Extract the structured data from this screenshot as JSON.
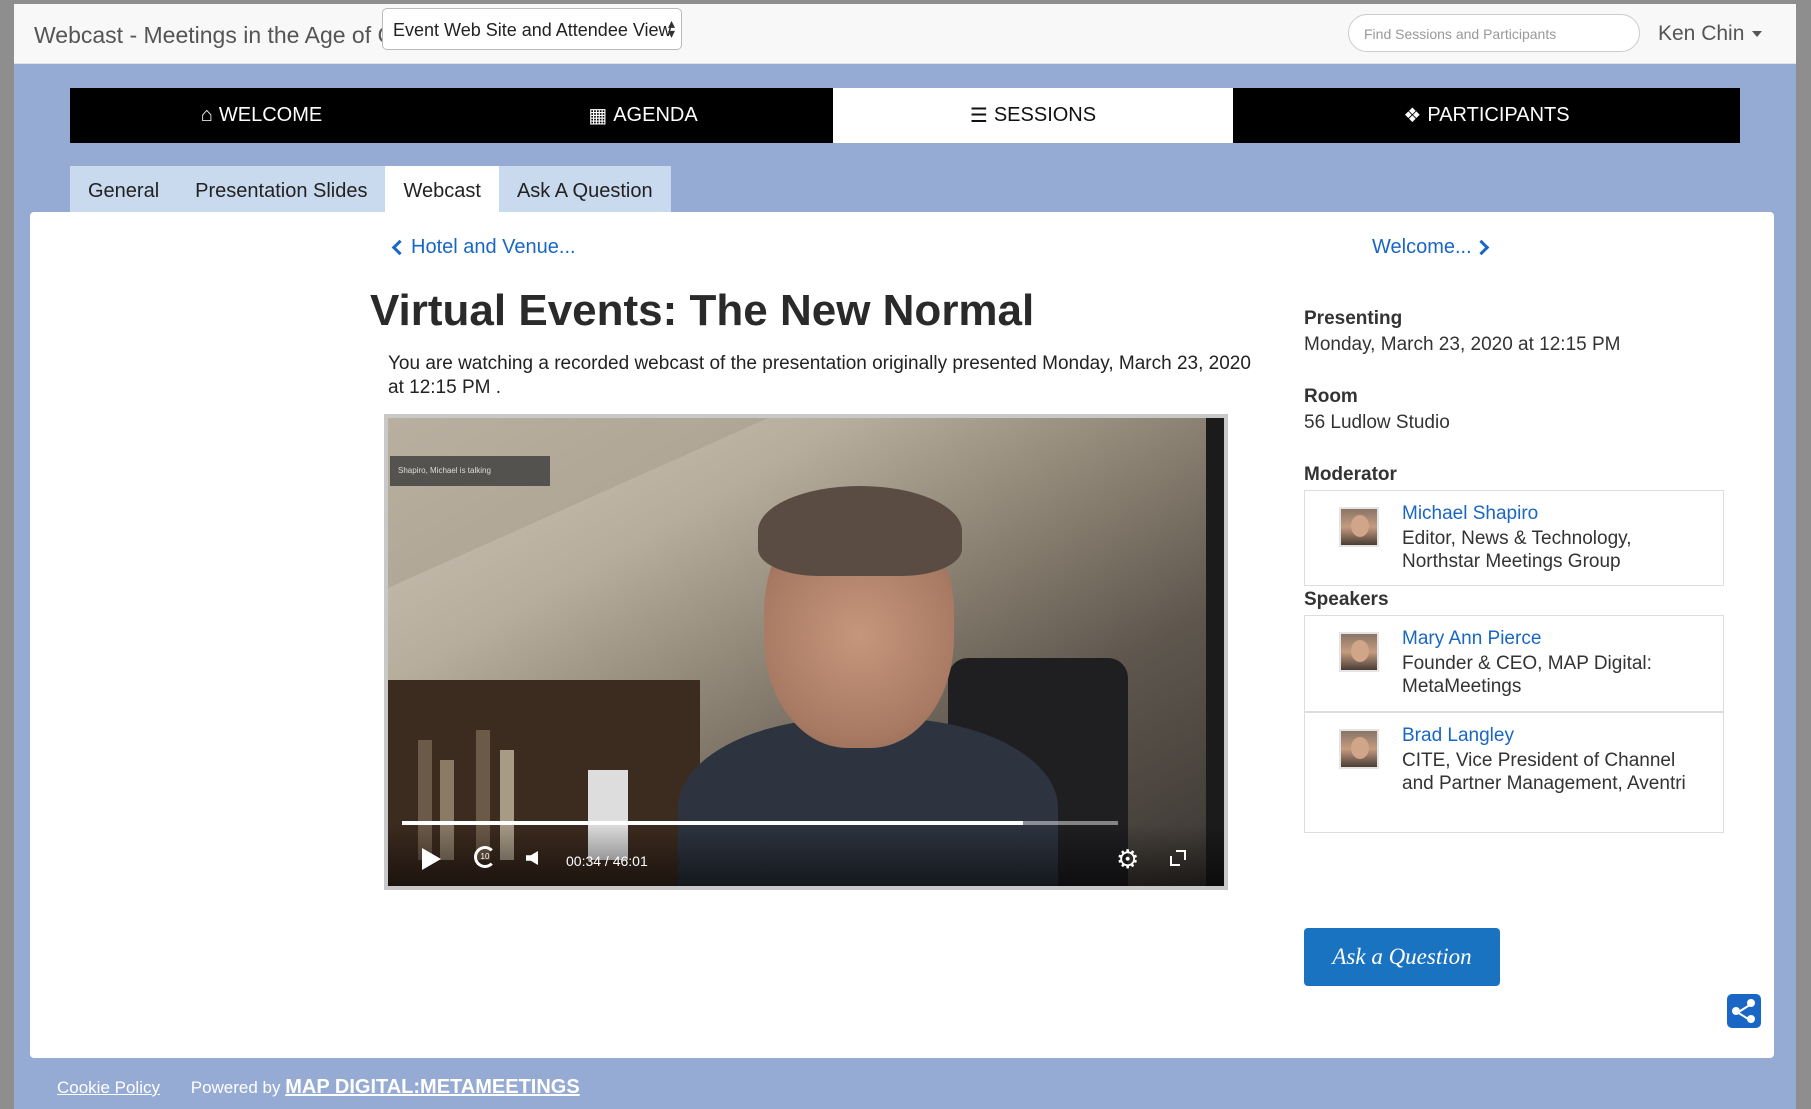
{
  "header": {
    "app_title": "Webcast - Meetings in the Age of C",
    "view_selector": "Event Web Site and Attendee View",
    "search_placeholder": "Find Sessions and Participants",
    "user_name": "Ken Chin"
  },
  "main_nav": [
    {
      "label": "WELCOME",
      "icon": "home-icon"
    },
    {
      "label": "AGENDA",
      "icon": "table-icon"
    },
    {
      "label": "SESSIONS",
      "icon": "list-icon",
      "active": true
    },
    {
      "label": "PARTICIPANTS",
      "icon": "users-icon"
    }
  ],
  "tabs": [
    {
      "label": "General"
    },
    {
      "label": "Presentation Slides"
    },
    {
      "label": "Webcast",
      "active": true
    },
    {
      "label": "Ask A Question"
    }
  ],
  "session": {
    "prev_link": "Hotel and Venue...",
    "next_link": "Welcome...",
    "title": "Virtual Events: The New Normal",
    "webcast_note": "You are watching a recorded webcast of the presentation originally presented Monday, March 23, 2020 at 12:15 PM ."
  },
  "video": {
    "talking_label": "Shapiro, Michael is talking",
    "current_time": "00:34",
    "duration": "46:01",
    "played_fraction": 0.868
  },
  "details": {
    "presenting_label": "Presenting",
    "presenting_value": "Monday, March 23, 2020 at 12:15 PM",
    "room_label": "Room",
    "room_value": "56 Ludlow Studio",
    "moderator_label": "Moderator",
    "speakers_label": "Speakers"
  },
  "moderator": {
    "name": "Michael Shapiro",
    "role": "Editor, News & Technology, Northstar Meetings Group"
  },
  "speakers": [
    {
      "name": "Mary Ann Pierce",
      "role": "Founder & CEO, MAP Digital: MetaMeetings"
    },
    {
      "name": "Brad Langley",
      "role": "CITE, Vice President of Channel and Partner Management, Aventri"
    }
  ],
  "actions": {
    "ask_question": "Ask a Question"
  },
  "footer": {
    "cookie_policy": "Cookie Policy",
    "powered_by": "Powered by",
    "brand": "MAP DIGITAL:METAMEETINGS"
  },
  "colors": {
    "page_bg": "#95abd3",
    "link": "#1a66c4",
    "button": "#1a73c0",
    "nav_bg": "#000000"
  }
}
